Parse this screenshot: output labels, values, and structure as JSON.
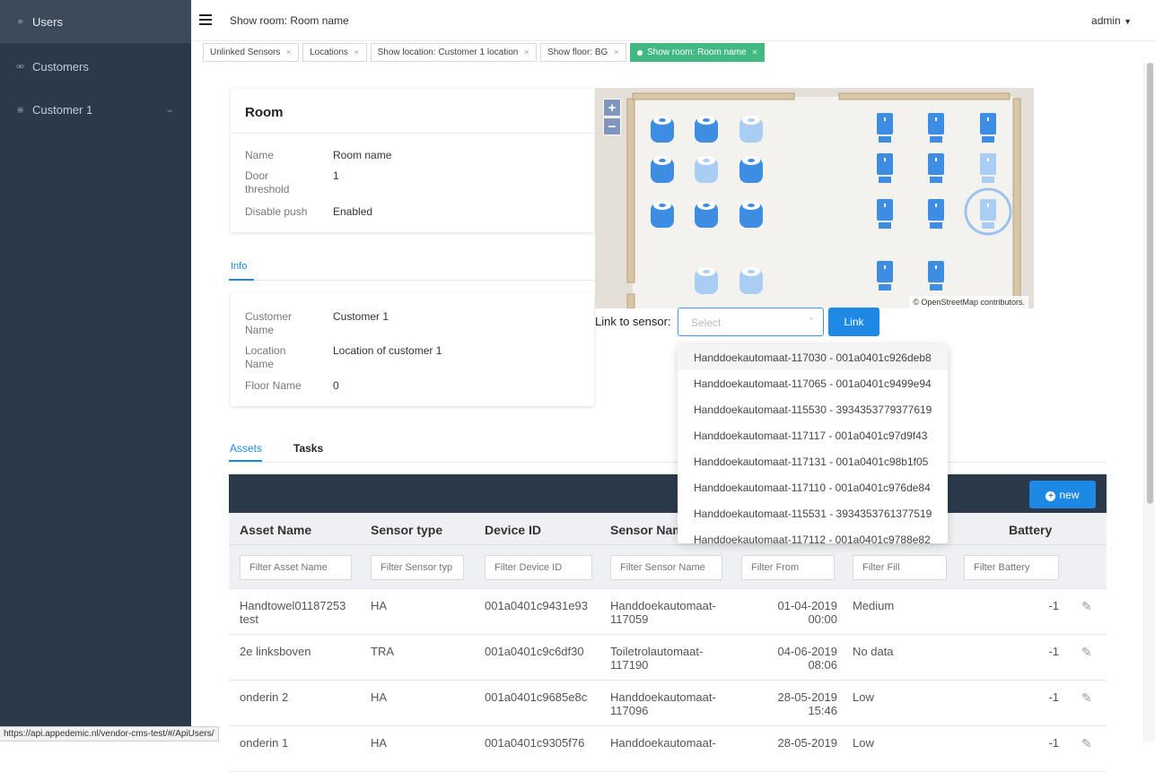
{
  "sidebar": {
    "items": [
      {
        "icon": "user-icon",
        "label": "Users"
      },
      {
        "icon": "customers-icon",
        "label": "Customers"
      },
      {
        "icon": "signal-icon",
        "label": "Customer 1"
      }
    ]
  },
  "header": {
    "title": "Show room: Room name",
    "user": "admin"
  },
  "tabs": [
    {
      "label": "Unlinked Sensors",
      "active": false
    },
    {
      "label": "Locations",
      "active": false
    },
    {
      "label": "Show location: Customer 1 location",
      "active": false
    },
    {
      "label": "Show floor: BG",
      "active": false
    },
    {
      "label": "Show room: Room name",
      "active": true
    }
  ],
  "room_card": {
    "title": "Room",
    "fields": [
      {
        "key": "Name",
        "value": "Room name"
      },
      {
        "key": "Door threshold",
        "value": "1"
      },
      {
        "key": "Disable push",
        "value": "Enabled"
      }
    ]
  },
  "info_tab": "Info",
  "info_card": {
    "fields": [
      {
        "key": "Customer Name",
        "value": "Customer 1"
      },
      {
        "key": "Location Name",
        "value": "Location of customer 1"
      },
      {
        "key": "Floor Name",
        "value": "0"
      }
    ]
  },
  "map": {
    "zoom_in": "+",
    "zoom_out": "−",
    "attribution": "© OpenStreetMap contributors."
  },
  "link_sensor": {
    "label": "Link to sensor:",
    "placeholder": "Select",
    "button": "Link",
    "options": [
      "Handdoekautomaat-117030 - 001a0401c926deb8",
      "Handdoekautomaat-117065 - 001a0401c9499e94",
      "Handdoekautomaat-115530 - 3934353779377619",
      "Handdoekautomaat-117117 - 001a0401c97d9f43",
      "Handdoekautomaat-117131 - 001a0401c98b1f05",
      "Handdoekautomaat-117110 - 001a0401c976de84",
      "Handdoekautomaat-115531 - 3934353761377519",
      "Handdoekautomaat-117112 - 001a0401c9788e82"
    ]
  },
  "asset_tabs": {
    "assets": "Assets",
    "tasks": "Tasks"
  },
  "table": {
    "new_button": "new",
    "columns": [
      "Asset Name",
      "Sensor type",
      "Device ID",
      "Sensor Name",
      "",
      "",
      "Battery"
    ],
    "filters": [
      "Filter Asset Name",
      "Filter Sensor typ",
      "Filter Device ID",
      "Filter Sensor Name",
      "Filter From",
      "Filter Fill",
      "Filter Battery"
    ],
    "rows": [
      {
        "asset_l1": "Handtowel01187253",
        "asset_l2": "test",
        "type": "HA",
        "device": "001a0401c9431e93",
        "sensor_l1": "Handdoekautomaat-",
        "sensor_l2": "117059",
        "date": "01-04-2019",
        "time": "00:00",
        "fill": "Medium",
        "battery": "-1"
      },
      {
        "asset_l1": "2e linksboven",
        "asset_l2": "",
        "type": "TRA",
        "device": "001a0401c9c6df30",
        "sensor_l1": "Toiletrolautomaat-",
        "sensor_l2": "117190",
        "date": "04-06-2019",
        "time": "08:06",
        "fill": "No data",
        "battery": "-1"
      },
      {
        "asset_l1": "onderin 2",
        "asset_l2": "",
        "type": "HA",
        "device": "001a0401c9685e8c",
        "sensor_l1": "Handdoekautomaat-",
        "sensor_l2": "117096",
        "date": "28-05-2019",
        "time": "15:46",
        "fill": "Low",
        "battery": "-1"
      },
      {
        "asset_l1": "onderin 1",
        "asset_l2": "",
        "type": "HA",
        "device": "001a0401c9305f76",
        "sensor_l1": "Handdoekautomaat-",
        "sensor_l2": "",
        "date": "28-05-2019",
        "time": "",
        "fill": "Low",
        "battery": "-1"
      }
    ]
  },
  "status_url": "https://api.appedemic.nl/vendor-cms-test/#/ApiUsers/"
}
